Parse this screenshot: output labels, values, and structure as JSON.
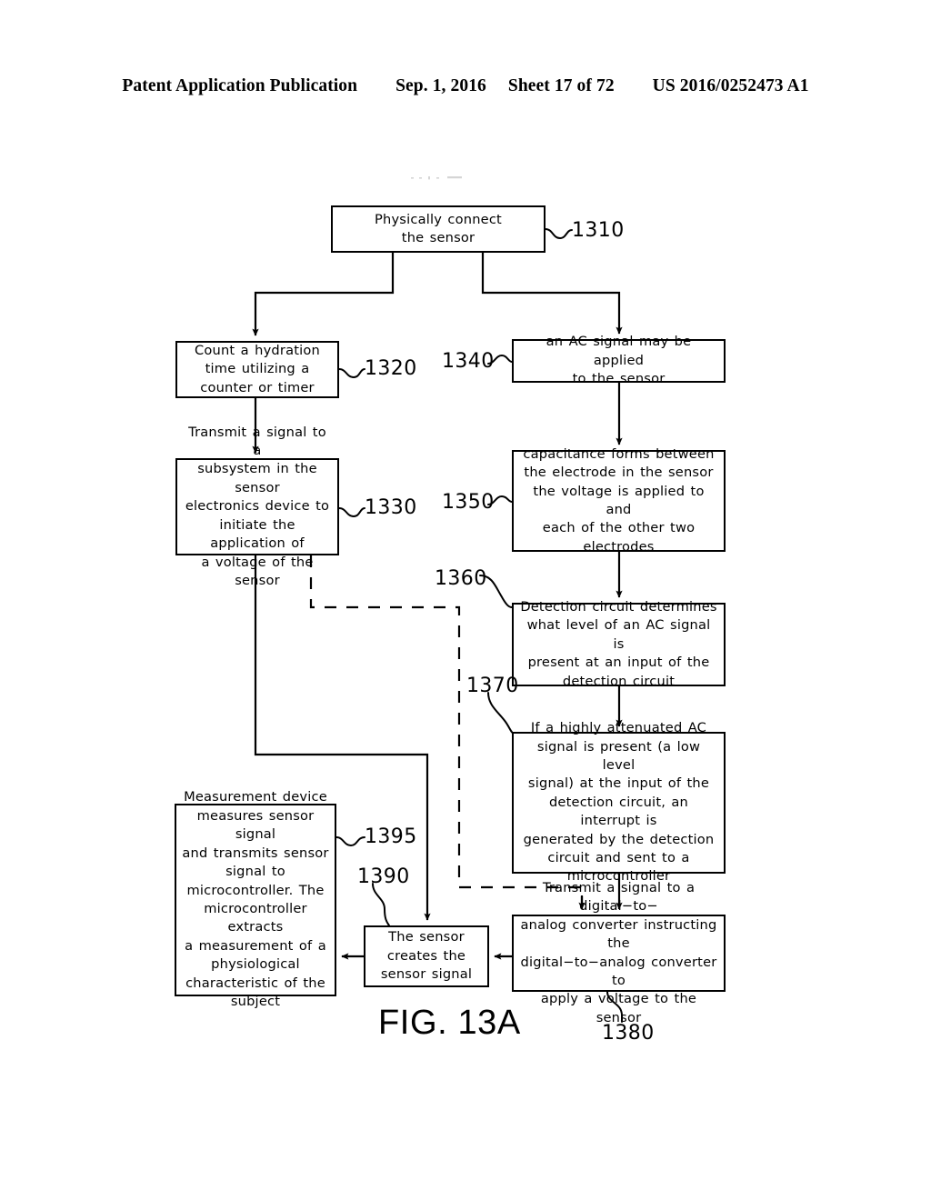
{
  "header": {
    "publication": "Patent Application Publication",
    "date": "Sep. 1, 2016",
    "sheet": "Sheet 17 of 72",
    "patent_number": "US 2016/0252473 A1"
  },
  "figure": {
    "caption": "FIG. 13A",
    "line_color": "#000000",
    "background_color": "#ffffff"
  },
  "flowchart": {
    "boxes": [
      {
        "ref": "1310",
        "text": "Physically connect\nthe sensor"
      },
      {
        "ref": "1320",
        "text": "Count a hydration\ntime utilizing a\ncounter or timer"
      },
      {
        "ref": "1330",
        "text": "Transmit a signal to a\nsubsystem in the sensor\nelectronics device to\ninitiate the application of\na voltage of the sensor"
      },
      {
        "ref": "1340",
        "text": "an AC signal may be applied\nto the sensor"
      },
      {
        "ref": "1350",
        "text": "capacitance forms between\nthe electrode in the sensor\nthe voltage is applied to and\neach of the other two\nelectrodes"
      },
      {
        "ref": "1360",
        "text": "Detection circuit determines\nwhat level of an AC signal is\npresent at an input of the\ndetection circuit"
      },
      {
        "ref": "1370",
        "text": "If a highly attenuated AC\nsignal is present (a low level\nsignal) at the input of the\ndetection circuit, an interrupt is\ngenerated by the detection\ncircuit and sent to a\nmicrocontroller"
      },
      {
        "ref": "1380",
        "text": "Transmit a signal to a digital−to−\nanalog converter instructing the\ndigital−to−analog converter to\napply a voltage to the sensor"
      },
      {
        "ref": "1390",
        "text": "The sensor\ncreates the\nsensor signal"
      },
      {
        "ref": "1395",
        "text": "Measurement device\nmeasures sensor signal\nand transmits sensor\nsignal to\nmicrocontroller.  The\nmicrocontroller extracts\na measurement of a\nphysiological\ncharacteristic of the\nsubject"
      }
    ],
    "labels": {
      "l1310": "1310",
      "l1320": "1320",
      "l1330": "1330",
      "l1340": "1340",
      "l1350": "1350",
      "l1360": "1360",
      "l1370": "1370",
      "l1380": "1380",
      "l1390": "1390",
      "l1395": "1395"
    }
  }
}
